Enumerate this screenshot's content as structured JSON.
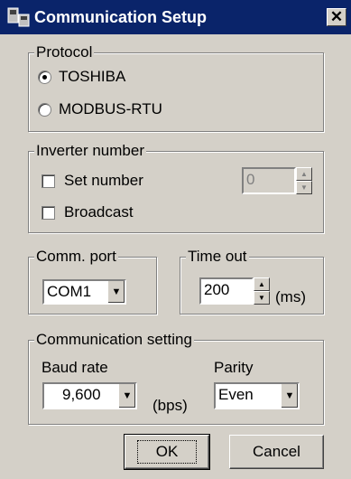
{
  "window": {
    "title": "Communication Setup",
    "close_glyph": "✕"
  },
  "protocol": {
    "legend": "Protocol",
    "options": [
      {
        "label": "TOSHIBA",
        "selected": true
      },
      {
        "label": "MODBUS-RTU",
        "selected": false
      }
    ]
  },
  "inverter": {
    "legend": "Inverter number",
    "set_number_label": "Set number",
    "broadcast_label": "Broadcast",
    "number_value": "0"
  },
  "comm_port": {
    "legend": "Comm. port",
    "value": "COM1"
  },
  "timeout": {
    "legend": "Time out",
    "value": "200",
    "unit": "(ms)"
  },
  "comm_setting": {
    "legend": "Communication setting",
    "baud_label": "Baud rate",
    "baud_value": "9,600",
    "baud_unit": "(bps)",
    "parity_label": "Parity",
    "parity_value": "Even"
  },
  "buttons": {
    "ok": "OK",
    "cancel": "Cancel"
  }
}
